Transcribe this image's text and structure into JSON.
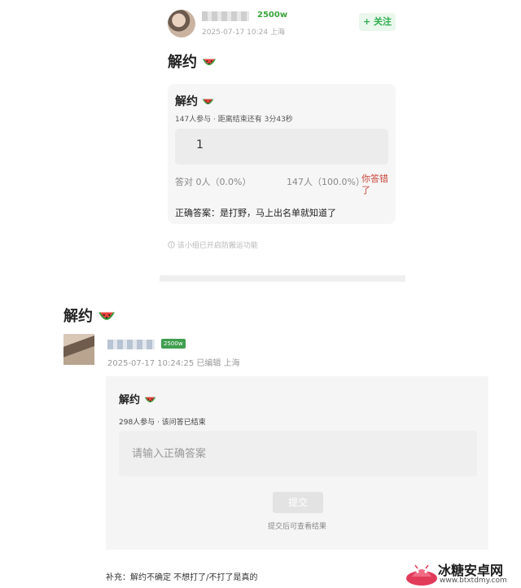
{
  "top_post": {
    "badge": "2500w",
    "meta": "2025-07-17 10:24 上海",
    "follow_label": "+ 关注",
    "title": "解约",
    "quiz": {
      "title": "解约",
      "participants": "147人参与 · 距离结束还有 3分43秒",
      "answer_value": "1",
      "correct_stat": "答对  0人（0.0%）",
      "total_stat": "147人（100.0%）",
      "wrong_label": "你答错了",
      "correct_answer": "正确答案：是打野，马上出名单就知道了"
    },
    "notice": "该小组已开启防搬运功能"
  },
  "bottom_post": {
    "title": "解约",
    "badge": "2500w",
    "meta": "2025-07-17 10:24:25 已编辑 上海",
    "quiz": {
      "title": "解约",
      "participants": "298人参与 · 该问答已结束",
      "input_placeholder": "请输入正确答案",
      "submit_label": "提交",
      "hint": "提交后可查看结果"
    },
    "supplement": "补充：解约不确定 不想打了/不打了是真的"
  },
  "watermark": {
    "name": "冰糖安卓网",
    "url": "www.btxtdmy.com"
  },
  "colors": {
    "accent_green": "#2fae4e",
    "wrong_red": "#c9473c",
    "badge_green": "#3f9f4f"
  },
  "icons": [
    "watermelon-emoji",
    "info-circle-icon",
    "android-logo"
  ]
}
